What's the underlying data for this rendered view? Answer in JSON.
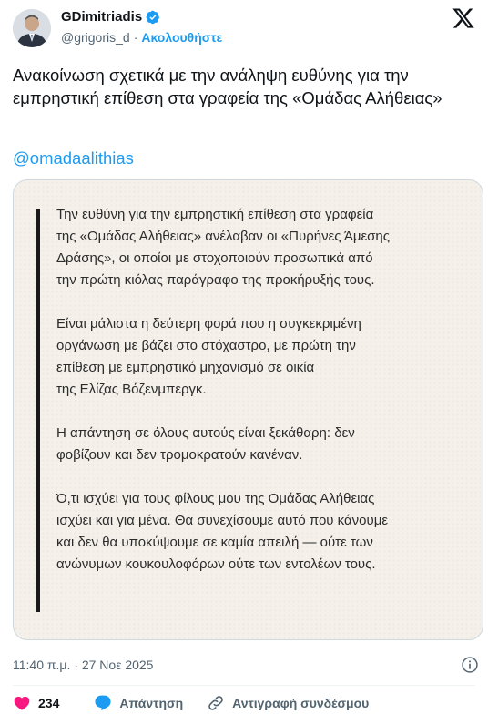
{
  "author": {
    "name": "GDimitriadis",
    "handle": "@grigoris_d",
    "separator": "·",
    "follow_label": "Ακολουθήστε"
  },
  "tweet": {
    "text": "Ανακοίνωση σχετικά με την ανάληψη ευθύνης για την εμπρηστική επίθεση στα γραφεία της «Ομάδας Αλήθειας»",
    "mention": "@omadaalithias"
  },
  "media": {
    "paragraphs": [
      "Την ευθύνη για την εμπρηστική επίθεση στα γραφεία\nτης «Ομάδας Αλήθειας» ανέλαβαν οι «Πυρήνες Άμεσης\nΔράσης», οι οποίοι με στοχοποιούν προσωπικά από\nτην πρώτη κιόλας παράγραφο της προκήρυξής τους.",
      "Είναι μάλιστα η δεύτερη φορά που η συγκεκριμένη\nοργάνωση με βάζει στο στόχαστρο, με πρώτη την\nεπίθεση με εμπρηστικό μηχανισμό σε οικία\nτης Ελίζας Βόζενμπεργκ.",
      "Η απάντηση σε όλους αυτούς είναι ξεκάθαρη: δεν\nφοβίζουν και δεν τρομοκρατούν κανέναν.",
      "Ό,τι ισχύει για τους φίλους μου της Ομάδας Αλήθειας\nισχύει και για μένα. Θα συνεχίσουμε αυτό που κάνουμε\nκαι δεν θα υποκύψουμε σε καμία απειλή — ούτε των\nανώνυμων κουκουλοφόρων ούτε των εντολέων τους."
    ]
  },
  "meta": {
    "timestamp": "11:40 π.μ. · 27 Νοε 2025"
  },
  "actions": {
    "like_count": "234",
    "reply_label": "Απάντηση",
    "copy_link_label": "Αντιγραφή συνδέσμου"
  },
  "colors": {
    "accent": "#1d9bf0",
    "like": "#f91880",
    "secondary_text": "#536471",
    "media_bg": "#f5f1ea"
  },
  "icons": [
    "verified-badge-icon",
    "x-logo-icon",
    "info-icon",
    "heart-icon",
    "reply-icon",
    "link-icon"
  ]
}
